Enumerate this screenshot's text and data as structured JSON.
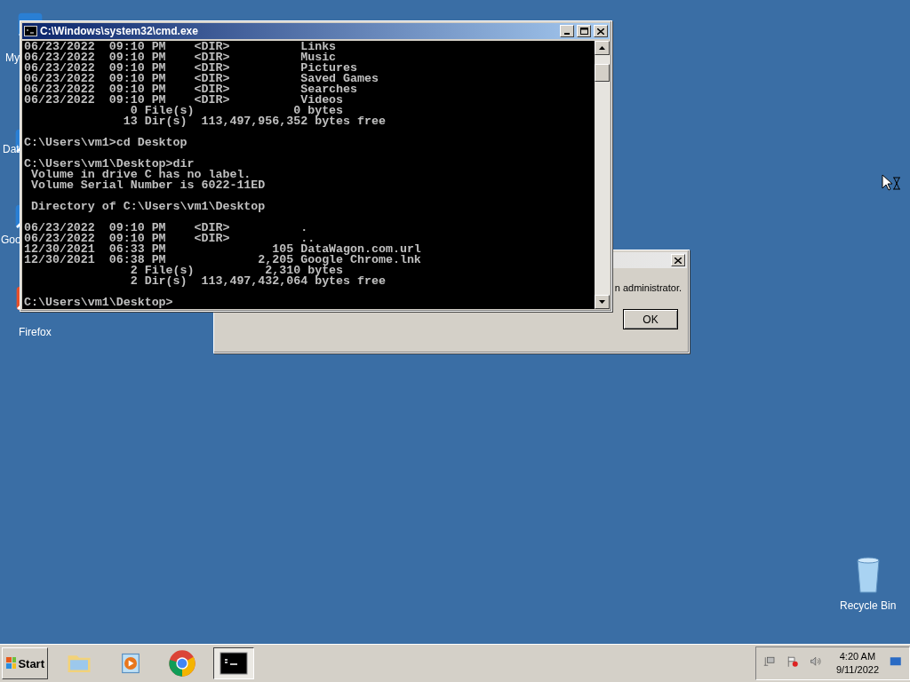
{
  "desktop_icons": [
    {
      "label": "My"
    },
    {
      "label": "Dat"
    },
    {
      "label": "Goo"
    },
    {
      "label": "Firefox"
    }
  ],
  "recycle_bin": {
    "label": "Recycle Bin"
  },
  "dialog": {
    "message": "n administrator.",
    "button": "OK"
  },
  "console": {
    "title": "C:\\Windows\\system32\\cmd.exe",
    "blocks": [
      [
        "06/23/2022  09:10 PM    <DIR>          Links",
        "06/23/2022  09:10 PM    <DIR>          Music",
        "06/23/2022  09:10 PM    <DIR>          Pictures",
        "06/23/2022  09:10 PM    <DIR>          Saved Games",
        "06/23/2022  09:10 PM    <DIR>          Searches",
        "06/23/2022  09:10 PM    <DIR>          Videos",
        "               0 File(s)              0 bytes",
        "              13 Dir(s)  113,497,956,352 bytes free"
      ],
      [
        "C:\\Users\\vm1>cd Desktop"
      ],
      [
        "C:\\Users\\vm1\\Desktop>dir",
        " Volume in drive C has no label.",
        " Volume Serial Number is 6022-11ED"
      ],
      [
        " Directory of C:\\Users\\vm1\\Desktop"
      ],
      [
        "06/23/2022  09:10 PM    <DIR>          .",
        "06/23/2022  09:10 PM    <DIR>          ..",
        "12/30/2021  06:33 PM               105 DataWagon.com.url",
        "12/30/2021  06:38 PM             2,205 Google Chrome.lnk",
        "               2 File(s)          2,310 bytes",
        "               2 Dir(s)  113,497,432,064 bytes free"
      ],
      [
        "C:\\Users\\vm1\\Desktop>"
      ]
    ]
  },
  "taskbar": {
    "start": "Start",
    "apps": [
      {
        "kind": "folder",
        "selected": false
      },
      {
        "kind": "media",
        "selected": false
      },
      {
        "kind": "chrome",
        "selected": false
      },
      {
        "kind": "console",
        "selected": true
      }
    ],
    "clock": {
      "time": "4:20 AM",
      "date": "9/11/2022"
    }
  }
}
